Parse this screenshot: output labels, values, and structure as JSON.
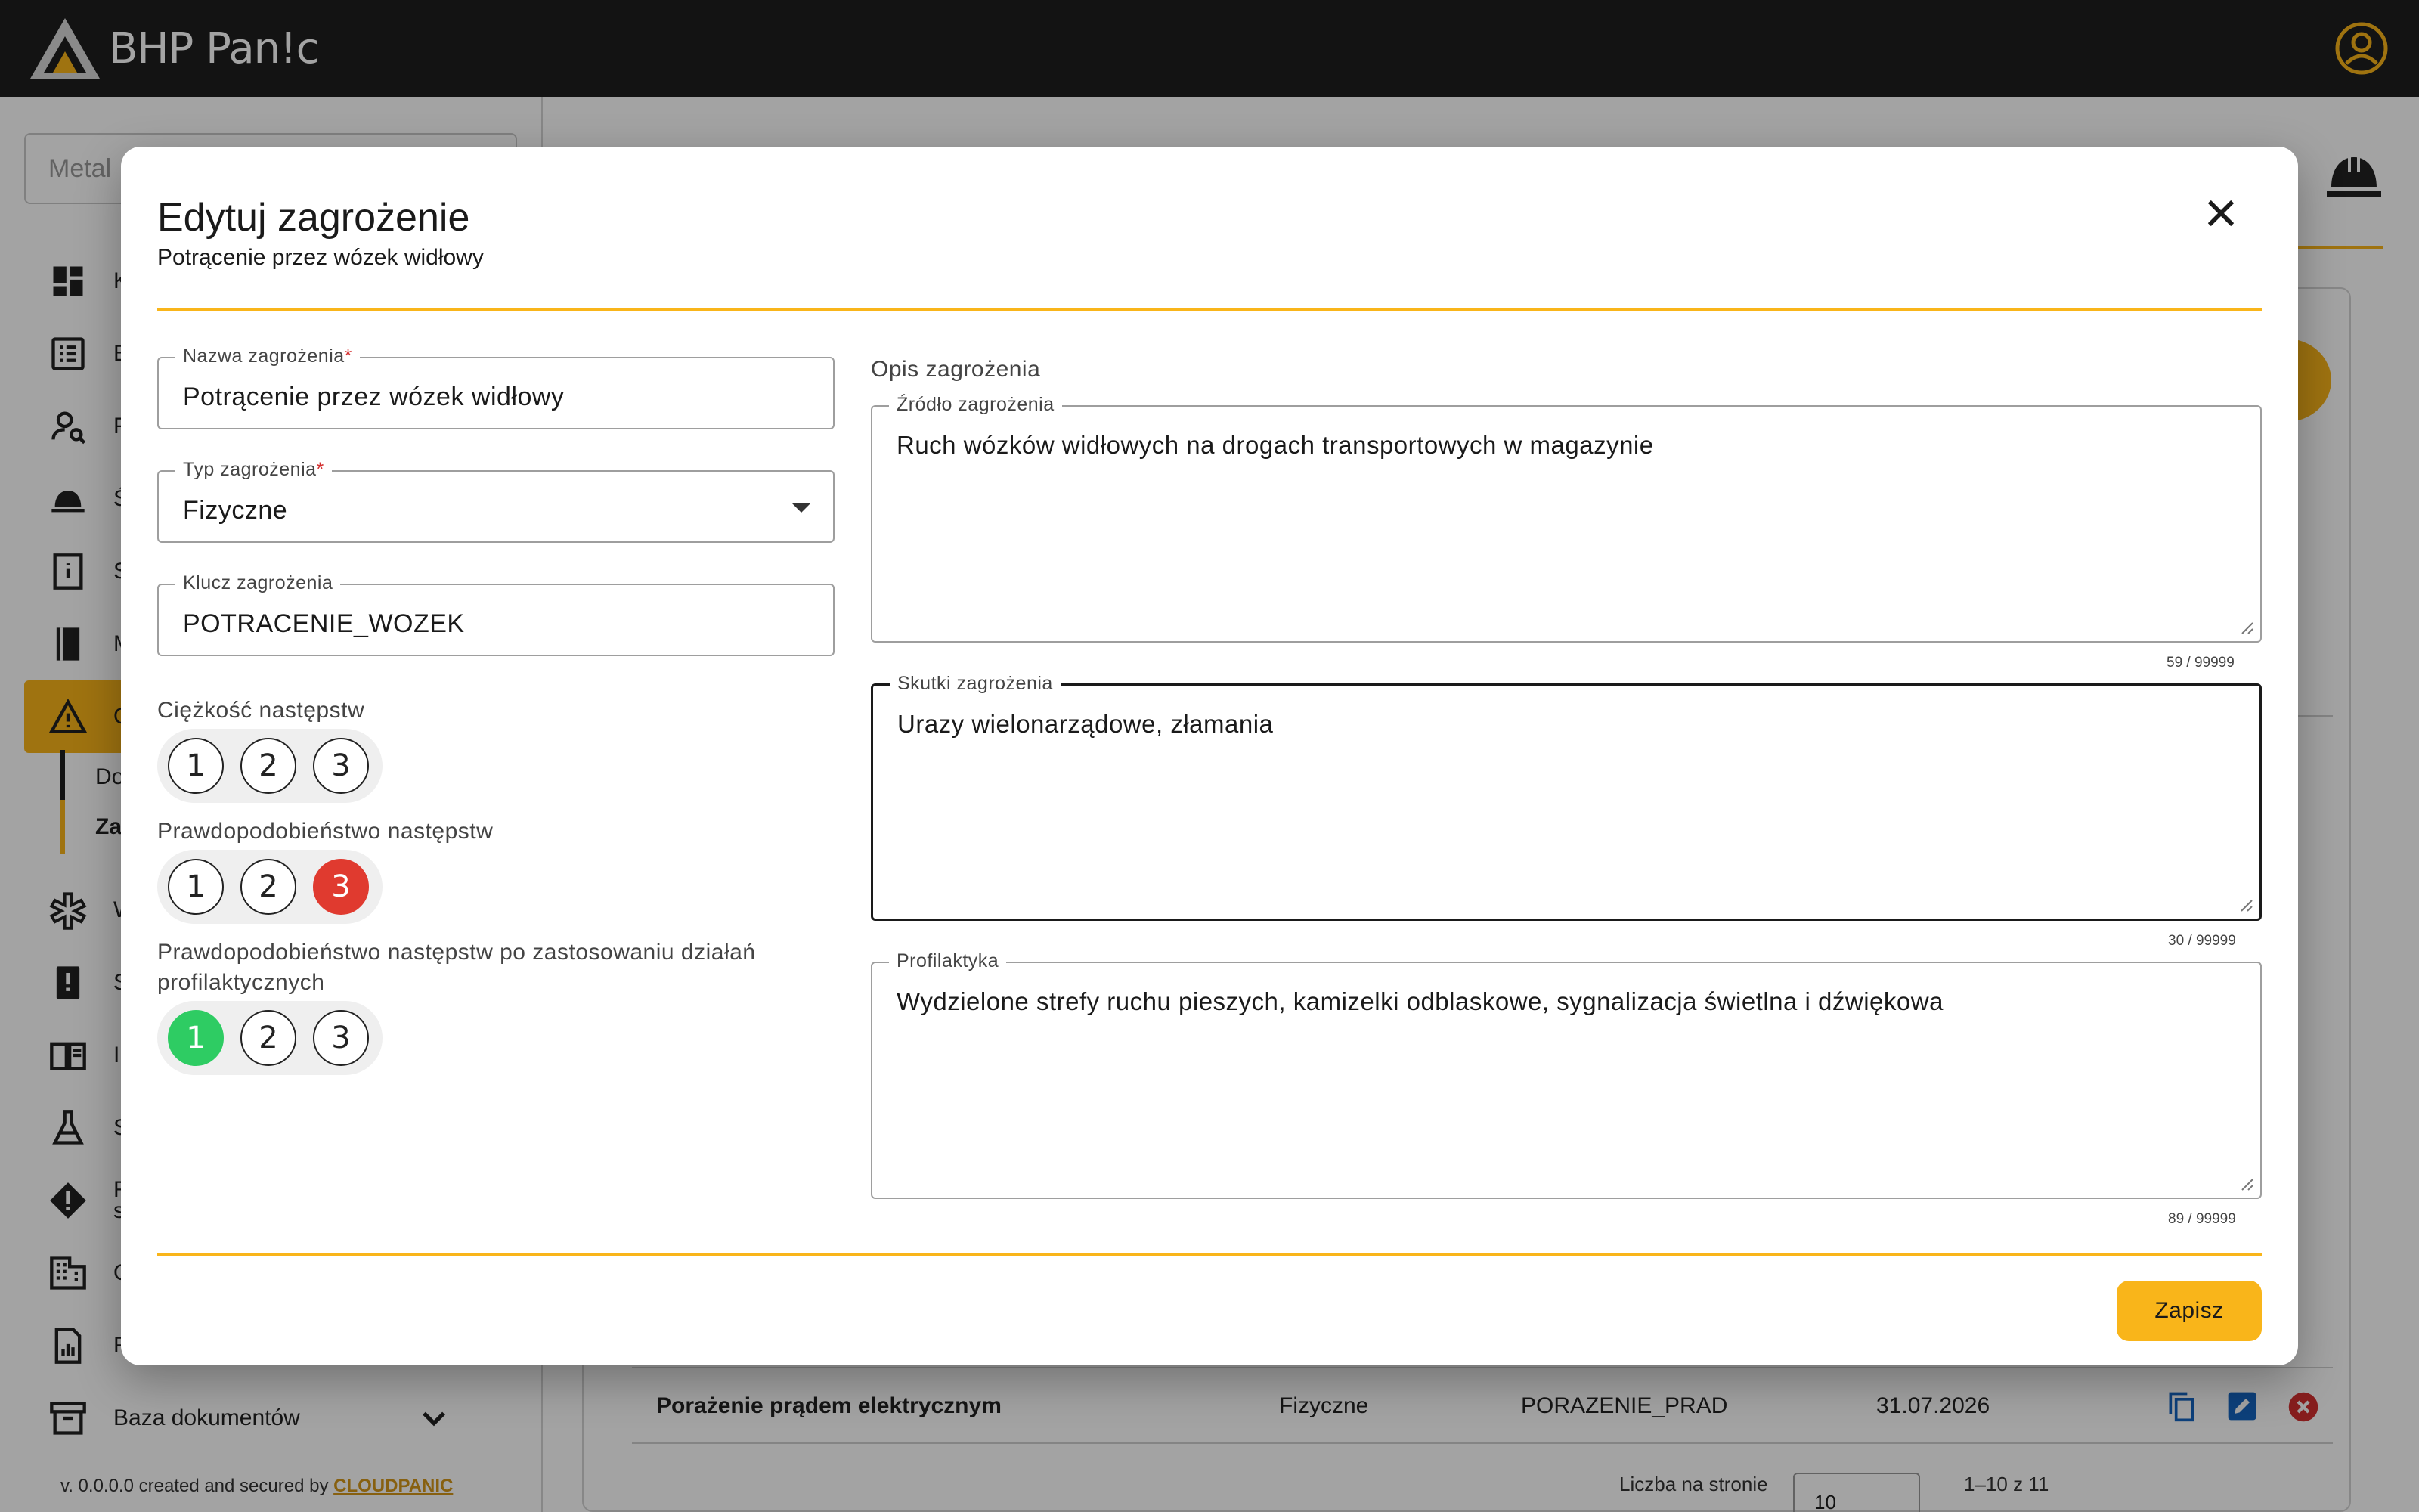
{
  "app": {
    "logo_text": "BHP Pan!c"
  },
  "sidebar": {
    "search_value": "Metal",
    "items": [
      {
        "label": "Ko",
        "icon": "dashboard-icon"
      },
      {
        "label": "Bł",
        "icon": "list-alt-icon"
      },
      {
        "label": "Pr",
        "icon": "person-search-icon"
      },
      {
        "label": "Śr",
        "icon": "helmet-icon"
      },
      {
        "label": "Sz",
        "icon": "book-info-icon"
      },
      {
        "label": "M",
        "icon": "book-icon"
      },
      {
        "label": "O",
        "icon": "warning-icon"
      },
      {
        "label": "W",
        "icon": "medical-icon"
      },
      {
        "label": "Sy",
        "icon": "report-icon"
      },
      {
        "label": "In",
        "icon": "menu-book-icon"
      },
      {
        "label": "Su",
        "icon": "flask-icon"
      },
      {
        "label": "Ro",
        "label2": "sz",
        "icon": "alert-diamond-icon"
      },
      {
        "label": "O",
        "icon": "building-icon"
      },
      {
        "label": "Ra",
        "icon": "report-chart-icon"
      },
      {
        "label": "Baza dokumentów",
        "icon": "inventory-icon"
      }
    ],
    "sub_items": [
      {
        "label": "Do"
      },
      {
        "label": "Za"
      }
    ],
    "footer_prefix": "v. 0.0.0.0 created and secured by",
    "footer_link": "CLOUDPANIC"
  },
  "background": {
    "last_row": {
      "name": "Porażenie prądem elektrycznym",
      "type": "Fizyczne",
      "key": "PORAZENIE_PRAD",
      "date": "31.07.2026"
    },
    "pager": {
      "label": "Liczba na stronie",
      "per_page": "10",
      "range": "1–10 z 11"
    }
  },
  "dialog": {
    "title": "Edytuj zagrożenie",
    "subtitle": "Potrącenie przez wózek widłowy",
    "fields": {
      "name": {
        "label": "Nazwa zagrożenia",
        "required_mark": "*",
        "value": "Potrącenie przez wózek widłowy"
      },
      "type": {
        "label": "Typ zagrożenia",
        "required_mark": "*",
        "value": "Fizyczne"
      },
      "key": {
        "label": "Klucz zagrożenia",
        "value": "POTRACENIE_WOZEK"
      }
    },
    "severity": {
      "label": "Ciężkość następstw",
      "options": [
        "1",
        "2",
        "3"
      ],
      "selected": null
    },
    "probability": {
      "label": "Prawdopodobieństwo następstw",
      "options": [
        "1",
        "2",
        "3"
      ],
      "selected": "3"
    },
    "probability_after": {
      "label_line1": "Prawdopodobieństwo następstw po zastosowaniu działań",
      "label_line2": "profilaktycznych",
      "options": [
        "1",
        "2",
        "3"
      ],
      "selected": "1"
    },
    "description": {
      "section_label": "Opis zagrożenia",
      "source": {
        "label": "Źródło zagrożenia",
        "value": "Ruch wózków widłowych na drogach transportowych w magazynie",
        "counter": "59 / 99999"
      },
      "effects": {
        "label": "Skutki zagrożenia",
        "value": "Urazy wielonarządowe, złamania",
        "counter": "30 / 99999"
      },
      "prevention": {
        "label": "Profilaktyka",
        "value": "Wydzielone strefy ruchu pieszych, kamizelki odblaskowe, sygnalizacja świetlna i dźwiękowa",
        "counter": "89 / 99999"
      }
    },
    "save_label": "Zapisz"
  },
  "colors": {
    "accent": "#f9b51a",
    "danger": "#e03a2f",
    "success": "#2ecc63",
    "topbar": "#1e1e1e"
  }
}
